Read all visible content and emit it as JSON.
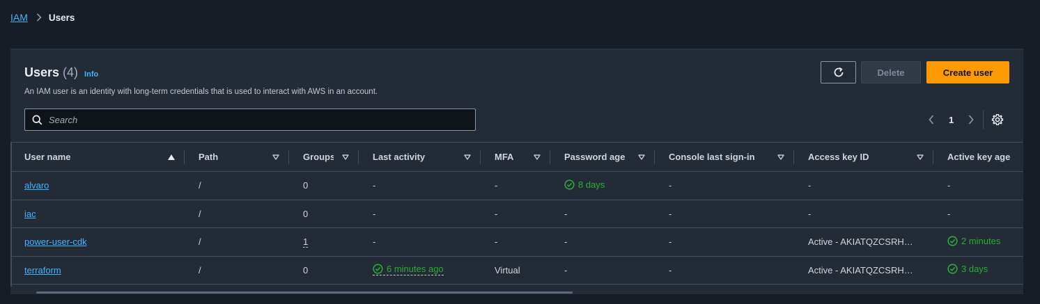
{
  "breadcrumb": {
    "root": "IAM",
    "current": "Users"
  },
  "header": {
    "title": "Users",
    "count": "(4)",
    "info": "Info",
    "description": "An IAM user is an identity with long-term credentials that is used to interact with AWS in an account."
  },
  "actions": {
    "delete": "Delete",
    "create": "Create user",
    "refresh_icon": "refresh-icon"
  },
  "search": {
    "placeholder": "Search",
    "value": ""
  },
  "pagination": {
    "page": "1"
  },
  "table": {
    "columns": [
      "User name",
      "Path",
      "Groups",
      "Last activity",
      "MFA",
      "Password age",
      "Console last sign-in",
      "Access key ID",
      "Active key age"
    ],
    "sort": {
      "column": "User name",
      "direction": "ascending"
    },
    "rows": [
      {
        "user": "alvaro",
        "path": "/",
        "groups": "0",
        "last_activity": "-",
        "mfa": "-",
        "password_age": "8 days",
        "console": "-",
        "access_key": "-",
        "key_age": "-"
      },
      {
        "user": "iac",
        "path": "/",
        "groups": "0",
        "last_activity": "-",
        "mfa": "-",
        "password_age": "-",
        "console": "-",
        "access_key": "-",
        "key_age": "-"
      },
      {
        "user": "power-user-cdk",
        "path": "/",
        "groups": "1",
        "last_activity": "-",
        "mfa": "-",
        "password_age": "-",
        "console": "-",
        "access_key": "Active - AKIATQZCSRH…",
        "key_age": "2 minutes"
      },
      {
        "user": "terraform",
        "path": "/",
        "groups": "0",
        "last_activity": "6 minutes ago",
        "mfa": "Virtual",
        "password_age": "-",
        "console": "-",
        "access_key": "Active - AKIATQZCSRH…",
        "key_age": "3 days"
      }
    ]
  },
  "colors": {
    "link": "#42b4ff",
    "primary": "#ff9900",
    "success": "#29ad32",
    "background": "#161d26",
    "panel": "#232b37"
  }
}
